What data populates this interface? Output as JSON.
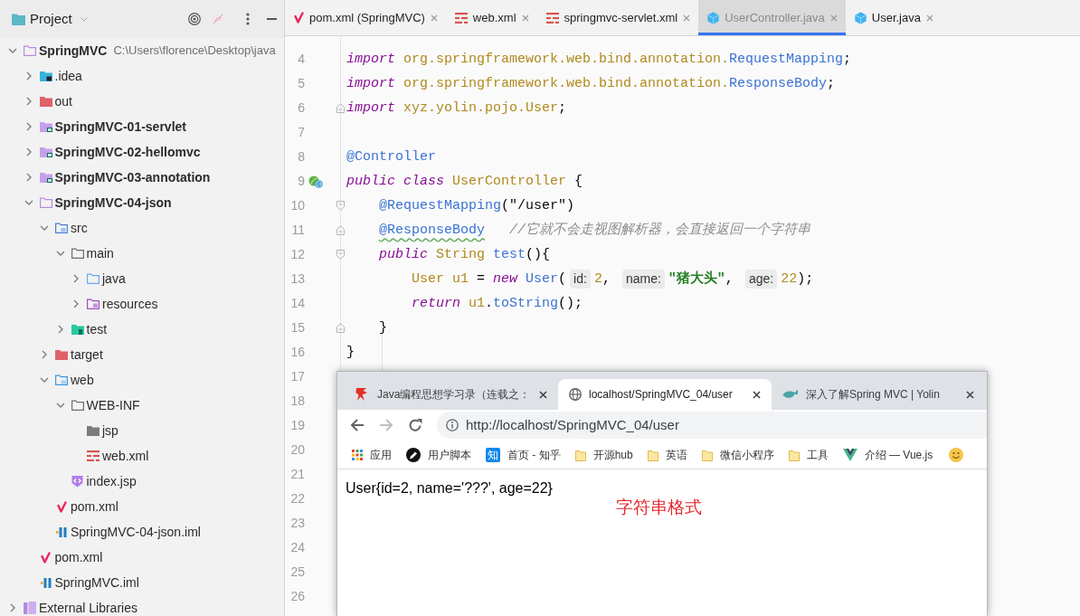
{
  "project_panel": {
    "title": "Project",
    "tree": [
      {
        "label": "SpringMVC",
        "kind": "module",
        "path": "C:\\Users\\florence\\Desktop\\java",
        "expanded": true,
        "children": [
          {
            "label": ".idea",
            "kind": "idea-folder",
            "expanded": false
          },
          {
            "label": "out",
            "kind": "excluded-folder",
            "expanded": false
          },
          {
            "label": "SpringMVC-01-servlet",
            "kind": "module",
            "expanded": false
          },
          {
            "label": "SpringMVC-02-hellomvc",
            "kind": "module",
            "expanded": false
          },
          {
            "label": "SpringMVC-03-annotation",
            "kind": "module",
            "expanded": false
          },
          {
            "label": "SpringMVC-04-json",
            "kind": "module",
            "expanded": true,
            "children": [
              {
                "label": "src",
                "kind": "source-root",
                "expanded": true,
                "children": [
                  {
                    "label": "main",
                    "kind": "folder",
                    "expanded": true,
                    "children": [
                      {
                        "label": "java",
                        "kind": "java-folder",
                        "expanded": false
                      },
                      {
                        "label": "resources",
                        "kind": "resources-folder",
                        "expanded": false
                      }
                    ]
                  },
                  {
                    "label": "test",
                    "kind": "test-folder",
                    "expanded": false
                  }
                ]
              },
              {
                "label": "target",
                "kind": "excluded-folder",
                "expanded": false
              },
              {
                "label": "web",
                "kind": "web-folder",
                "expanded": true,
                "children": [
                  {
                    "label": "WEB-INF",
                    "kind": "folder",
                    "expanded": true,
                    "children": [
                      {
                        "label": "jsp",
                        "kind": "plain-folder"
                      },
                      {
                        "label": "web.xml",
                        "kind": "xml-file"
                      }
                    ]
                  },
                  {
                    "label": "index.jsp",
                    "kind": "jsp-file"
                  }
                ]
              },
              {
                "label": "pom.xml",
                "kind": "maven-file"
              },
              {
                "label": "SpringMVC-04-json.iml",
                "kind": "iml-file"
              }
            ]
          },
          {
            "label": "pom.xml",
            "kind": "maven-file"
          },
          {
            "label": "SpringMVC.iml",
            "kind": "iml-file"
          }
        ]
      },
      {
        "label": "External Libraries",
        "kind": "libraries",
        "expanded": false
      }
    ]
  },
  "editor": {
    "tabs": [
      {
        "label": "pom.xml (SpringMVC)",
        "kind": "maven",
        "selected": false
      },
      {
        "label": "web.xml",
        "kind": "xml",
        "selected": false
      },
      {
        "label": "springmvc-servlet.xml",
        "kind": "xml",
        "selected": false
      },
      {
        "label": "UserController.java",
        "kind": "java-class",
        "selected": true
      },
      {
        "label": "User.java",
        "kind": "java-class",
        "selected": false
      }
    ],
    "lines": [
      {
        "number": "4",
        "tokens": [
          {
            "text": "import",
            "kind": "keyword"
          },
          {
            "text": " org.springframework.web.bind.annotation.",
            "kind": "identifier"
          },
          {
            "text": "RequestMapping",
            "kind": "reference"
          },
          {
            "text": ";",
            "kind": "plain"
          }
        ]
      },
      {
        "number": "5",
        "tokens": [
          {
            "text": "import",
            "kind": "keyword"
          },
          {
            "text": " org.springframework.web.bind.annotation.",
            "kind": "identifier"
          },
          {
            "text": "ResponseBody",
            "kind": "reference"
          },
          {
            "text": ";",
            "kind": "plain"
          }
        ]
      },
      {
        "number": "6",
        "markers": [
          {
            "kind": "fold-end"
          }
        ],
        "tokens": [
          {
            "text": "import",
            "kind": "keyword"
          },
          {
            "text": " xyz.yolin.pojo.User",
            "kind": "identifier"
          },
          {
            "text": ";",
            "kind": "plain"
          }
        ]
      },
      {
        "number": "7"
      },
      {
        "number": "8",
        "tokens": [
          {
            "text": "@Controller",
            "kind": "reference"
          }
        ]
      },
      {
        "number": "9",
        "markers": [
          {
            "kind": "bean"
          }
        ],
        "tokens": [
          {
            "text": "public",
            "kind": "keyword"
          },
          {
            "text": " class",
            "kind": "keyword"
          },
          {
            "text": " UserController",
            "kind": "identifier"
          },
          {
            "text": " {",
            "kind": "plain"
          }
        ]
      },
      {
        "number": "10",
        "markers": [
          {
            "kind": "fold-start"
          }
        ],
        "tokens": [
          {
            "text": "    @RequestMapping",
            "kind": "reference"
          },
          {
            "text": "(\"/user\")",
            "kind": "plain"
          }
        ]
      },
      {
        "number": "11",
        "markers": [
          {
            "kind": "fold-end"
          }
        ],
        "tokens": [
          {
            "text": "    @ResponseBody",
            "kind": "reference",
            "squiggly": true
          },
          {
            "text": "   //它就不会走视图解析器，会直接返回一个字符串",
            "kind": "comment"
          }
        ]
      },
      {
        "number": "12",
        "markers": [
          {
            "kind": "fold-start"
          }
        ],
        "tokens": [
          {
            "text": "    public",
            "kind": "keyword"
          },
          {
            "text": " String",
            "kind": "identifier"
          },
          {
            "text": " test",
            "kind": "reference"
          },
          {
            "text": "(){",
            "kind": "plain"
          }
        ]
      },
      {
        "number": "13",
        "tokens": [
          {
            "text": "        User u1",
            "kind": "identifier"
          },
          {
            "text": " = ",
            "kind": "plain"
          },
          {
            "text": "new",
            "kind": "keyword"
          },
          {
            "text": " User",
            "kind": "reference"
          },
          {
            "text": "(",
            "kind": "plain"
          },
          {
            "text": "id:",
            "kind": "hint"
          },
          {
            "text": "2",
            "kind": "number"
          },
          {
            "text": ", ",
            "kind": "plain"
          },
          {
            "text": "name:",
            "kind": "hint"
          },
          {
            "text": "\"猪大头\"",
            "kind": "string"
          },
          {
            "text": ", ",
            "kind": "plain"
          },
          {
            "text": "age:",
            "kind": "hint"
          },
          {
            "text": "22",
            "kind": "number"
          },
          {
            "text": ");",
            "kind": "plain"
          }
        ]
      },
      {
        "number": "14",
        "tokens": [
          {
            "text": "        return",
            "kind": "keyword"
          },
          {
            "text": " u1",
            "kind": "identifier"
          },
          {
            "text": ".",
            "kind": "plain"
          },
          {
            "text": "toString",
            "kind": "reference"
          },
          {
            "text": "();",
            "kind": "plain"
          }
        ]
      },
      {
        "number": "15",
        "markers": [
          {
            "kind": "fold-end"
          }
        ],
        "tokens": [
          {
            "text": "    }",
            "kind": "plain"
          }
        ]
      },
      {
        "number": "16",
        "tokens": [
          {
            "text": "}",
            "kind": "plain"
          }
        ]
      },
      {
        "number": "17"
      },
      {
        "number": "18"
      },
      {
        "number": "19"
      },
      {
        "number": "20"
      },
      {
        "number": "21"
      },
      {
        "number": "22"
      },
      {
        "number": "23"
      },
      {
        "number": "24"
      },
      {
        "number": "25"
      },
      {
        "number": "26"
      }
    ]
  },
  "browser": {
    "tabs": [
      {
        "label": "Java编程思想学习录（连载之：",
        "kind": "site-logo",
        "selected": false
      },
      {
        "label": "localhost/SpringMVC_04/user",
        "kind": "globe",
        "selected": true
      },
      {
        "label": "深入了解Spring MVC | Yolin",
        "kind": "whale",
        "selected": false
      }
    ],
    "navigation": [
      {
        "kind": "back",
        "disabled": false
      },
      {
        "kind": "forward",
        "disabled": true
      },
      {
        "kind": "reload",
        "disabled": false
      }
    ],
    "address_bar": {
      "url": "http://localhost/SpringMVC_04/user"
    },
    "bookmarks": [
      {
        "label": "应用",
        "kind": "apps"
      },
      {
        "label": "用户脚本",
        "kind": "userscript"
      },
      {
        "label": "首页 - 知乎",
        "kind": "badge",
        "icon_text": "知"
      },
      {
        "label": "开源hub",
        "kind": "folder"
      },
      {
        "label": "英语",
        "kind": "folder"
      },
      {
        "label": "微信小程序",
        "kind": "folder"
      },
      {
        "label": "工具",
        "kind": "folder"
      },
      {
        "label": "介绍 — Vue.js",
        "kind": "vue"
      },
      {
        "kind": "emoji"
      }
    ],
    "page": {
      "text": "User{id=2, name='???', age=22}",
      "annotation": "字符串格式"
    }
  }
}
